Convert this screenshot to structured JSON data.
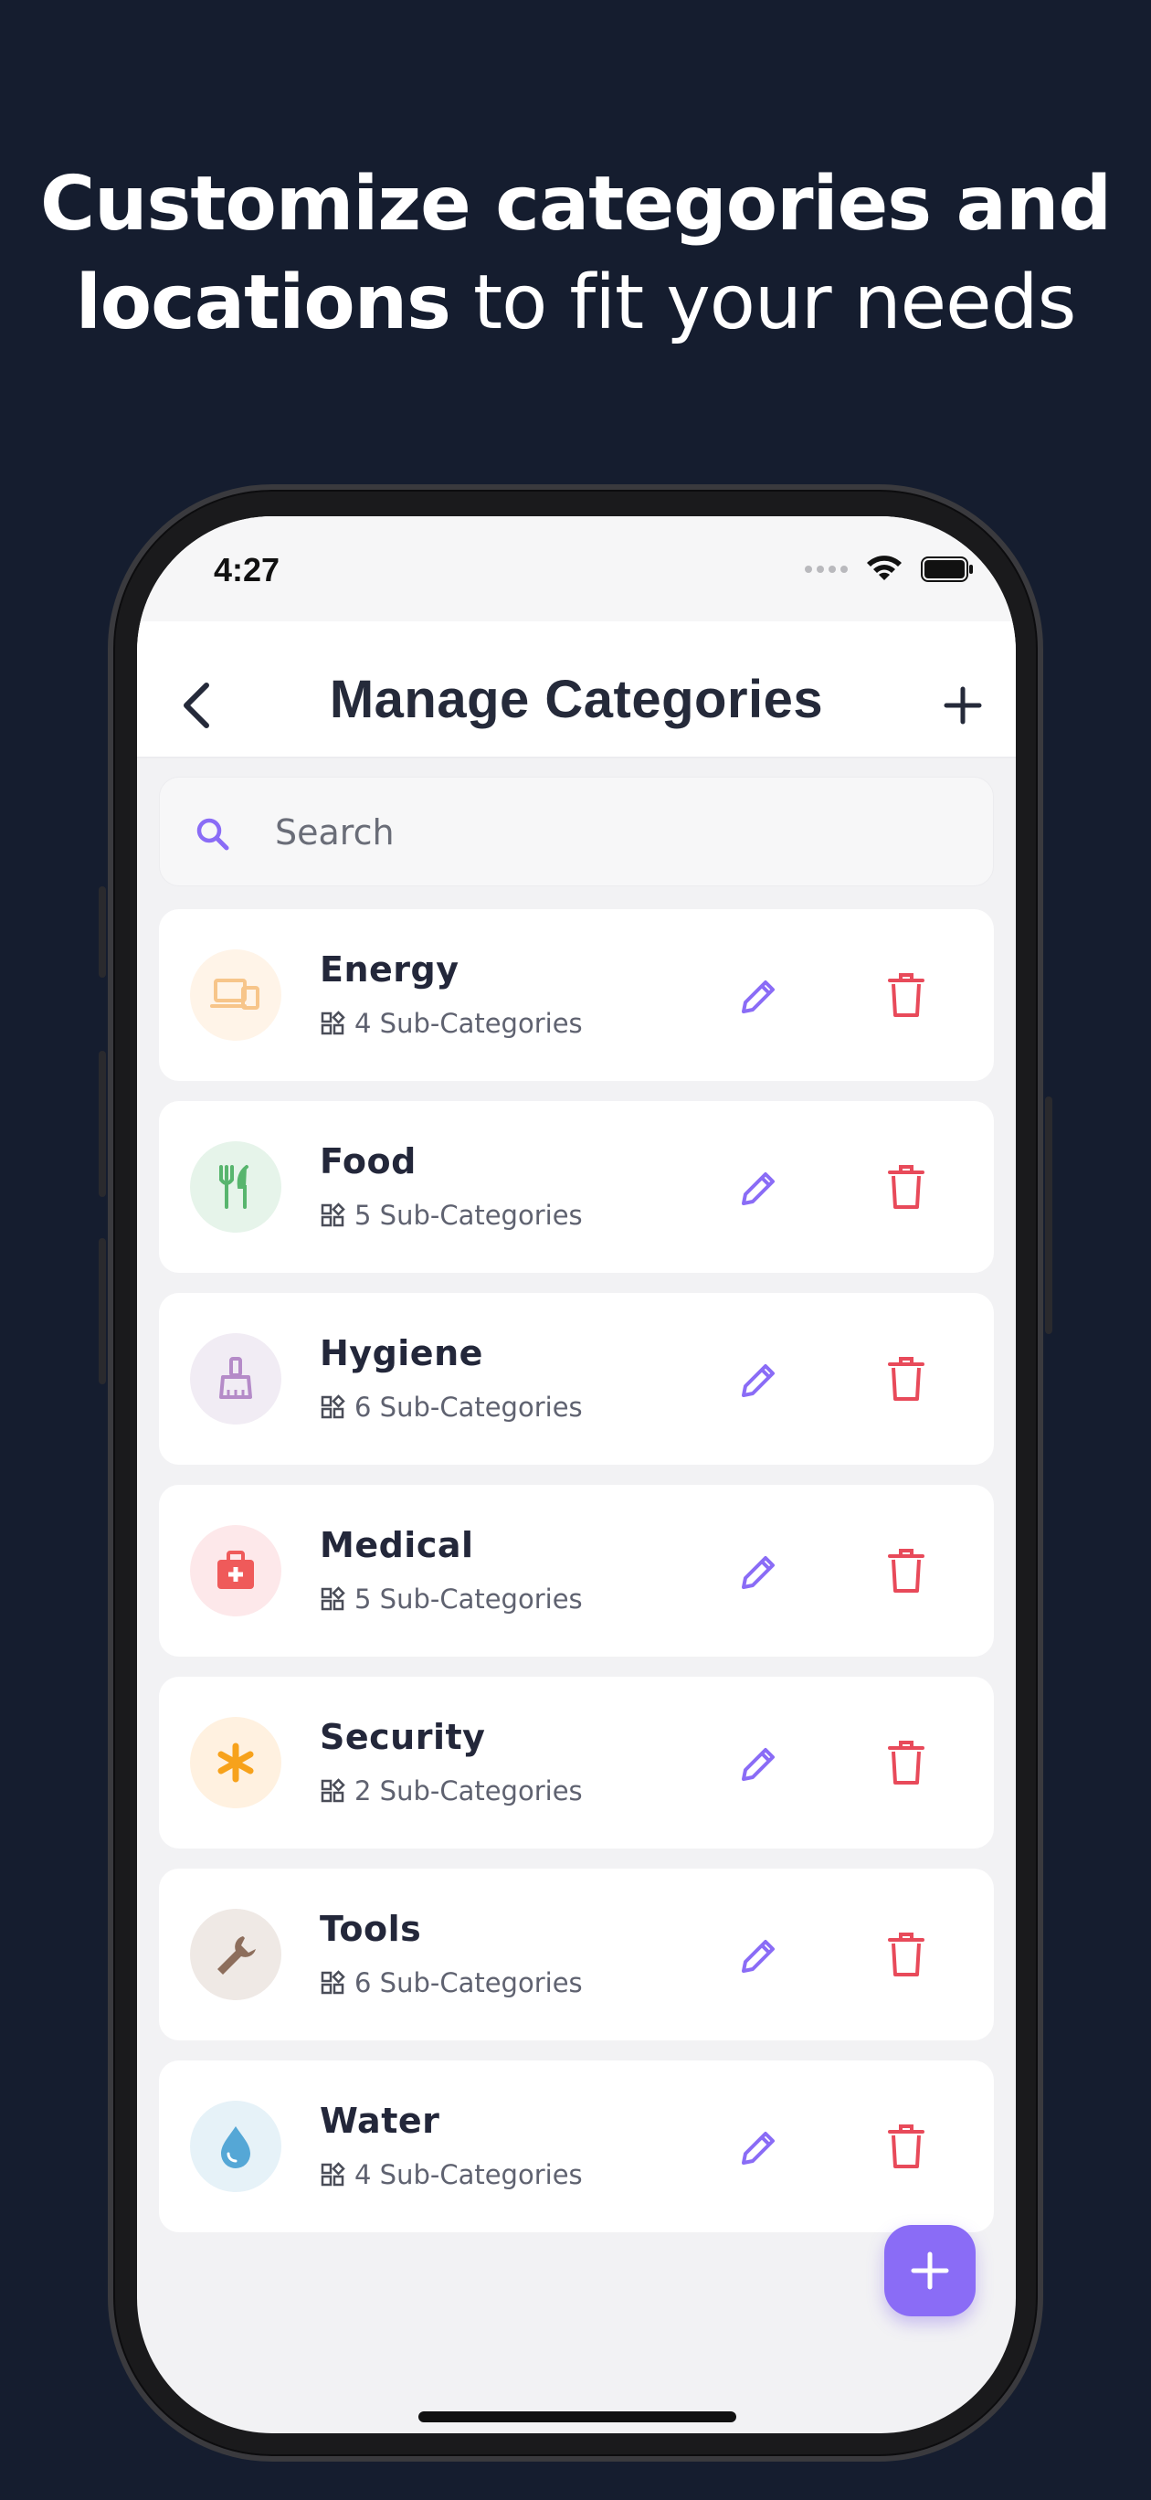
{
  "headline": {
    "bold": "Customize categories and",
    "bold2": "locations",
    "rest": " to fit your needs"
  },
  "status_bar": {
    "time": "4:27"
  },
  "nav": {
    "title": "Manage Categories"
  },
  "search": {
    "placeholder": "Search"
  },
  "colors": {
    "accent": "#8a6cf6",
    "delete": "#e84a5a",
    "background": "#151d2f"
  },
  "categories": [
    {
      "name": "Energy",
      "sub": "4 Sub-Categories",
      "icon": "devices-icon",
      "bg": "#fff4e8",
      "fg": "#f7c58a"
    },
    {
      "name": "Food",
      "sub": "5 Sub-Categories",
      "icon": "utensils-icon",
      "bg": "#e6f4ea",
      "fg": "#58b56e"
    },
    {
      "name": "Hygiene",
      "sub": "6 Sub-Categories",
      "icon": "brush-icon",
      "bg": "#f1ecf4",
      "fg": "#b58bc8"
    },
    {
      "name": "Medical",
      "sub": "5 Sub-Categories",
      "icon": "first-aid-icon",
      "bg": "#fde8ea",
      "fg": "#ef5a5a"
    },
    {
      "name": "Security",
      "sub": "2 Sub-Categories",
      "icon": "asterisk-icon",
      "bg": "#fff1e0",
      "fg": "#f7a21b"
    },
    {
      "name": "Tools",
      "sub": "6 Sub-Categories",
      "icon": "wrench-icon",
      "bg": "#efe9e5",
      "fg": "#8d6e5c"
    },
    {
      "name": "Water",
      "sub": "4 Sub-Categories",
      "icon": "drop-icon",
      "bg": "#e6f2f8",
      "fg": "#55a7d6"
    }
  ]
}
